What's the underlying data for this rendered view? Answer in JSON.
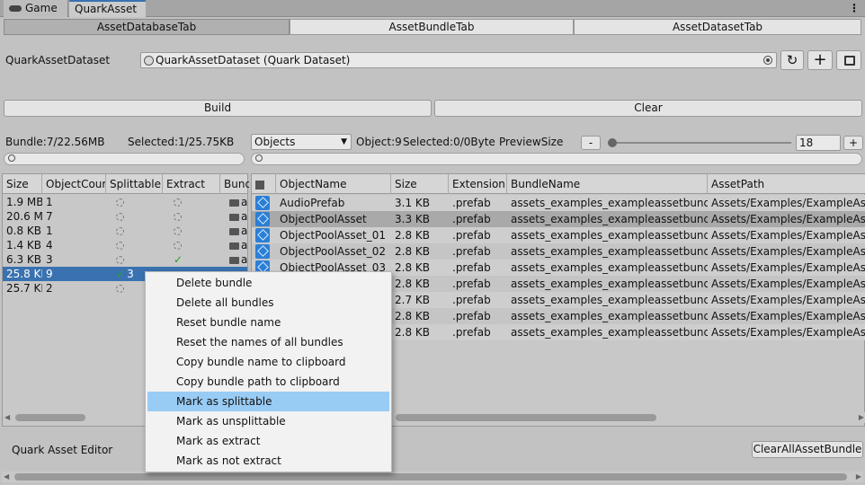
{
  "window_tabs": {
    "game": "Game",
    "quark": "QuarkAsset"
  },
  "sub_tabs": [
    "AssetDatabaseTab",
    "AssetBundleTab",
    "AssetDatasetTab"
  ],
  "dataset": {
    "label": "QuarkAssetDataset",
    "value": "QuarkAssetDataset (Quark Dataset)"
  },
  "buttons": {
    "build": "Build",
    "clear": "Clear",
    "clear_all": "ClearAllAssetBundle"
  },
  "bundle_info": {
    "bundle": "Bundle:7/22.56MB",
    "selected": "Selected:1/25.75KB"
  },
  "objects_panel": {
    "dropdown": "Objects",
    "object_info": "Object:9",
    "selected_info": "Selected:0/0Byte",
    "preview_label": "PreviewSize",
    "minus": "-",
    "plus": "+",
    "preview_value": "18",
    "slider_value": 0.0
  },
  "bundle_table": {
    "headers": [
      "Size",
      "ObjectCour",
      "Splittable",
      "Extract",
      "Bund"
    ],
    "rows": [
      {
        "size": "1.9 MB",
        "count": "1",
        "extract": false,
        "name": "a"
      },
      {
        "size": "20.6 M",
        "count": "7",
        "extract": false,
        "name": "a"
      },
      {
        "size": "0.8 KB",
        "count": "1",
        "extract": false,
        "name": "a"
      },
      {
        "size": "1.4 KB",
        "count": "4",
        "extract": false,
        "name": "a"
      },
      {
        "size": "6.3 KB",
        "count": "3",
        "extract": true,
        "name": "a"
      },
      {
        "size": "25.8 KI",
        "count": "9",
        "extract": false,
        "name": "",
        "split_label": "3"
      },
      {
        "size": "25.7 KI",
        "count": "2",
        "extract": false,
        "name": ""
      }
    ]
  },
  "object_table": {
    "headers": [
      "ObjectName",
      "Size",
      "Extension",
      "BundleName",
      "AssetPath"
    ],
    "rows": [
      {
        "name": "AudioPrefab",
        "size": "3.1 KB",
        "ext": ".prefab",
        "bundle": "assets_examples_exampleassetbundle",
        "path": "Assets/Examples/ExampleAsse"
      },
      {
        "name": "ObjectPoolAsset",
        "size": "3.3 KB",
        "ext": ".prefab",
        "bundle": "assets_examples_exampleassetbundle",
        "path": "Assets/Examples/ExampleAsse"
      },
      {
        "name": "ObjectPoolAsset_01",
        "size": "2.8 KB",
        "ext": ".prefab",
        "bundle": "assets_examples_exampleassetbundle",
        "path": "Assets/Examples/ExampleAsse"
      },
      {
        "name": "ObjectPoolAsset_02",
        "size": "2.8 KB",
        "ext": ".prefab",
        "bundle": "assets_examples_exampleassetbundle",
        "path": "Assets/Examples/ExampleAsse"
      },
      {
        "name": "ObjectPoolAsset_03",
        "size": "2.8 KB",
        "ext": ".prefab",
        "bundle": "assets_examples_exampleassetbundle",
        "path": "Assets/Examples/ExampleAsse"
      },
      {
        "name": "",
        "size": "2.8 KB",
        "ext": ".prefab",
        "bundle": "assets_examples_exampleassetbundle",
        "path": "Assets/Examples/ExampleAsse"
      },
      {
        "name": "",
        "size": "2.7 KB",
        "ext": ".prefab",
        "bundle": "assets_examples_exampleassetbundle",
        "path": "Assets/Examples/ExampleAsse"
      },
      {
        "name": "",
        "size": "2.8 KB",
        "ext": ".prefab",
        "bundle": "assets_examples_exampleassetbundle",
        "path": "Assets/Examples/ExampleAsse"
      },
      {
        "name": "",
        "size": "2.8 KB",
        "ext": ".prefab",
        "bundle": "assets_examples_exampleassetbundle",
        "path": "Assets/Examples/ExampleAsse"
      }
    ]
  },
  "context_menu": {
    "items": [
      "Delete bundle",
      "Delete all bundles",
      "Reset bundle name",
      "Reset the names of all bundles",
      "Copy bundle name to clipboard",
      "Copy bundle path to clipboard",
      "Mark as splittable",
      "Mark as unsplittable",
      "Mark as extract",
      "Mark as not extract"
    ],
    "highlighted_index": 6
  },
  "footer": {
    "title": "Quark Asset Editor"
  },
  "colors": {
    "selection": "#3a72b0",
    "menu_highlight": "#99ccf5",
    "asset_icon": "#2c7fd6",
    "check": "#2aa12a"
  }
}
